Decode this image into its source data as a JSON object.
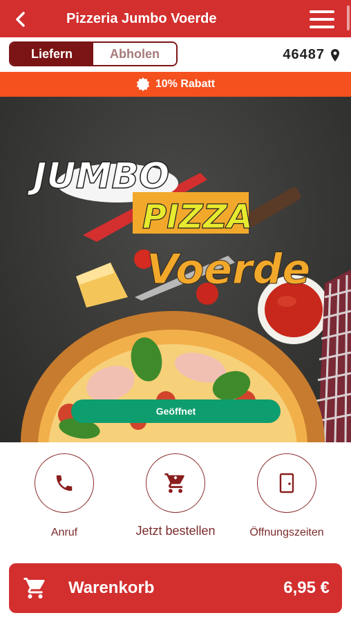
{
  "header": {
    "title": "Pizzeria Jumbo Voerde",
    "back_icon": "chevron-left-icon",
    "menu_icon": "hamburger-menu-icon",
    "color": "#d32f2f"
  },
  "order_mode": {
    "options": [
      "Liefern",
      "Abholen"
    ],
    "selected": "Liefern",
    "active_color": "#7b1414"
  },
  "location": {
    "postal_code": "46487",
    "icon": "map-pin-icon"
  },
  "banner": {
    "text": "10% Rabatt",
    "icon": "discount-badge-icon",
    "color": "#f4511e"
  },
  "hero": {
    "logo_text": {
      "line1": "JUMBO",
      "line2": "PIZZA",
      "line3": "Voerde"
    },
    "status_label": "Geöffnet",
    "status_color": "#0e9d6e"
  },
  "actions": [
    {
      "label": "Anruf",
      "icon": "phone-icon"
    },
    {
      "label": "Jetzt bestellen",
      "icon": "shopping-cart-icon"
    },
    {
      "label": "Öffnungszeiten",
      "icon": "door-icon"
    }
  ],
  "cart": {
    "label": "Warenkorb",
    "total": "6,95 €",
    "icon": "shopping-cart-icon"
  }
}
